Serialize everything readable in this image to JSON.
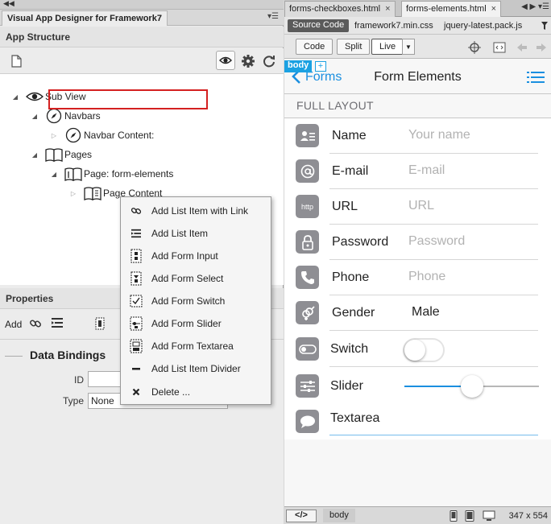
{
  "left_panel": {
    "window_title": "Visual App Designer for Framework7",
    "app_structure_title": "App Structure",
    "tree": [
      {
        "label": "Sub View",
        "icon": "eye-icon"
      },
      {
        "label": "Navbars",
        "icon": "compass-icon"
      },
      {
        "label": "Navbar Content:",
        "icon": "compass-icon"
      },
      {
        "label": "Pages",
        "icon": "book-icon"
      },
      {
        "label": "Page: form-elements",
        "icon": "page-icon",
        "selected": true
      },
      {
        "label": "Page Content",
        "icon": "page-content-icon"
      }
    ],
    "properties_title": "Properties",
    "add_label": "Add",
    "data_bindings_title": "Data Bindings",
    "id_label": "ID",
    "id_value": "",
    "type_label": "Type",
    "type_value": "None"
  },
  "context_menu": {
    "items": [
      {
        "label": "Add List Item with Link",
        "icon": "link-icon"
      },
      {
        "label": "Add List Item",
        "icon": "list-item-icon"
      },
      {
        "label": "Add Form Input",
        "icon": "form-input-icon"
      },
      {
        "label": "Add Form Select",
        "icon": "form-select-icon"
      },
      {
        "label": "Add Form Switch",
        "icon": "form-switch-icon"
      },
      {
        "label": "Add Form Slider",
        "icon": "form-slider-icon"
      },
      {
        "label": "Add Form Textarea",
        "icon": "form-textarea-icon"
      },
      {
        "label": "Add List Item Divider",
        "icon": "divider-icon"
      },
      {
        "label": "Delete ...",
        "icon": "delete-icon"
      }
    ]
  },
  "editor": {
    "tabs": [
      {
        "label": "forms-checkboxes.html",
        "active": false
      },
      {
        "label": "forms-elements.html",
        "active": true
      }
    ],
    "source_code_label": "Source Code",
    "related_files": [
      "framework7.min.css",
      "jquery-latest.pack.js"
    ],
    "view_buttons": {
      "code": "Code",
      "split": "Split",
      "live": "Live"
    },
    "body_tag": "body",
    "plus_tag": "+",
    "status": {
      "code_tag": "</>",
      "crumb": "body",
      "dimensions": "347 x 554"
    }
  },
  "preview": {
    "back_label": "Forms",
    "title": "Form Elements",
    "block_title": "FULL LAYOUT",
    "accent_color": "#1a8fe0",
    "rows": [
      {
        "label": "Name",
        "value": "Your name",
        "kind": "input",
        "icon": "person-card-icon"
      },
      {
        "label": "E-mail",
        "value": "E-mail",
        "kind": "input",
        "icon": "at-icon"
      },
      {
        "label": "URL",
        "value": "URL",
        "kind": "input",
        "icon": "http-icon",
        "icon_text": "http"
      },
      {
        "label": "Password",
        "value": "Password",
        "kind": "input",
        "icon": "lock-icon"
      },
      {
        "label": "Phone",
        "value": "Phone",
        "kind": "input",
        "icon": "phone-icon"
      },
      {
        "label": "Gender",
        "value": "Male",
        "kind": "select",
        "icon": "gender-icon"
      },
      {
        "label": "Switch",
        "value": "",
        "kind": "switch",
        "icon": "toggle-icon",
        "on": false
      },
      {
        "label": "Slider",
        "value": "",
        "kind": "slider",
        "icon": "sliders-icon",
        "level": 0.5
      },
      {
        "label": "Textarea",
        "value": "",
        "kind": "textarea",
        "icon": "speech-bubble-icon"
      }
    ]
  }
}
